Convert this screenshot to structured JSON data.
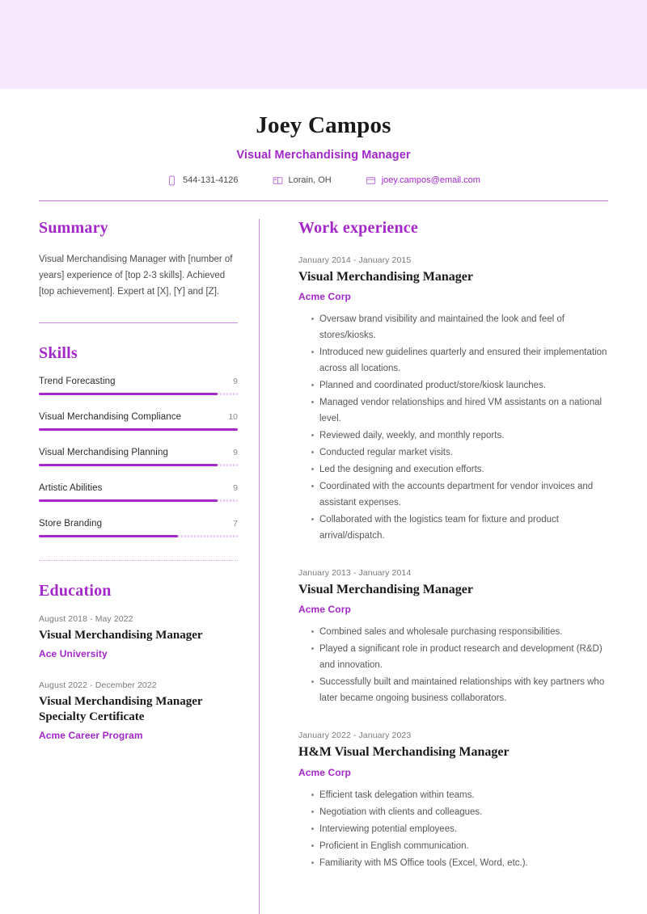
{
  "theme": {
    "accent": "#A327C9",
    "band": "#F6E7FB",
    "rule": "#BF78D6",
    "muted_text": "#575757",
    "date_text": "#7A7A7A"
  },
  "header": {
    "full_name": "Joey Campos",
    "job_title": "Visual Merchandising Manager",
    "contacts": [
      {
        "icon": "phone-icon",
        "text": "544-131-4126",
        "is_link": false
      },
      {
        "icon": "location-icon",
        "text": "Lorain, OH",
        "is_link": false
      },
      {
        "icon": "email-icon",
        "text": "joey.campos@email.com",
        "is_link": true
      }
    ]
  },
  "left_column": {
    "summary": {
      "title": "Summary",
      "text": "Visual Merchandising Manager with [number of years] experience of [top 2-3 skills]. Achieved [top achievement]. Expert at [X], [Y] and [Z]."
    },
    "skills": {
      "title": "Skills",
      "max": 10,
      "items": [
        {
          "name": "Trend Forecasting",
          "score": "9",
          "value": 9
        },
        {
          "name": "Visual Merchandising Compliance",
          "score": "10",
          "value": 10
        },
        {
          "name": "Visual Merchandising Planning",
          "score": "9",
          "value": 9
        },
        {
          "name": "Artistic Abilities",
          "score": "9",
          "value": 9
        },
        {
          "name": "Store Branding",
          "score": "7",
          "value": 7
        }
      ]
    },
    "education": {
      "title": "Education",
      "items": [
        {
          "date": "August 2018 - May 2022",
          "title": "Visual Merchandising Manager",
          "org": "Ace University"
        },
        {
          "date": "August 2022 - December 2022",
          "title": "Visual Merchandising Manager Specialty Certificate",
          "org": "Acme Career Program"
        }
      ]
    }
  },
  "right_column": {
    "work_experience": {
      "title": "Work experience",
      "items": [
        {
          "date": "January 2014 - January 2015",
          "title": "Visual Merchandising Manager",
          "org": "Acme Corp",
          "bullets": [
            "Oversaw brand visibility and maintained the look and feel of stores/kiosks.",
            "Introduced new guidelines quarterly and ensured their implementation across all locations.",
            "Planned and coordinated product/store/kiosk launches.",
            "Managed vendor relationships and hired VM assistants on a national level.",
            "Reviewed daily, weekly, and monthly reports.",
            "Conducted regular market visits.",
            "Led the designing and execution efforts.",
            "Coordinated with the accounts department for vendor invoices and assistant expenses.",
            "Collaborated with the logistics team for fixture and product arrival/dispatch."
          ]
        },
        {
          "date": "January 2013 - January 2014",
          "title": "Visual Merchandising Manager",
          "org": "Acme Corp",
          "bullets": [
            "Combined sales and wholesale purchasing responsibilities.",
            "Played a significant role in product research and development (R&D) and innovation.",
            "Successfully built and maintained relationships with key partners who later became ongoing business collaborators."
          ]
        },
        {
          "date": "January 2022 - January 2023",
          "title": "H&M Visual Merchandising Manager",
          "org": "Acme Corp",
          "bullets": [
            "Efficient task delegation within teams.",
            "Negotiation with clients and colleagues.",
            "Interviewing potential employees.",
            "Proficient in English communication.",
            "Familiarity with MS Office tools (Excel, Word, etc.)."
          ]
        }
      ]
    }
  }
}
